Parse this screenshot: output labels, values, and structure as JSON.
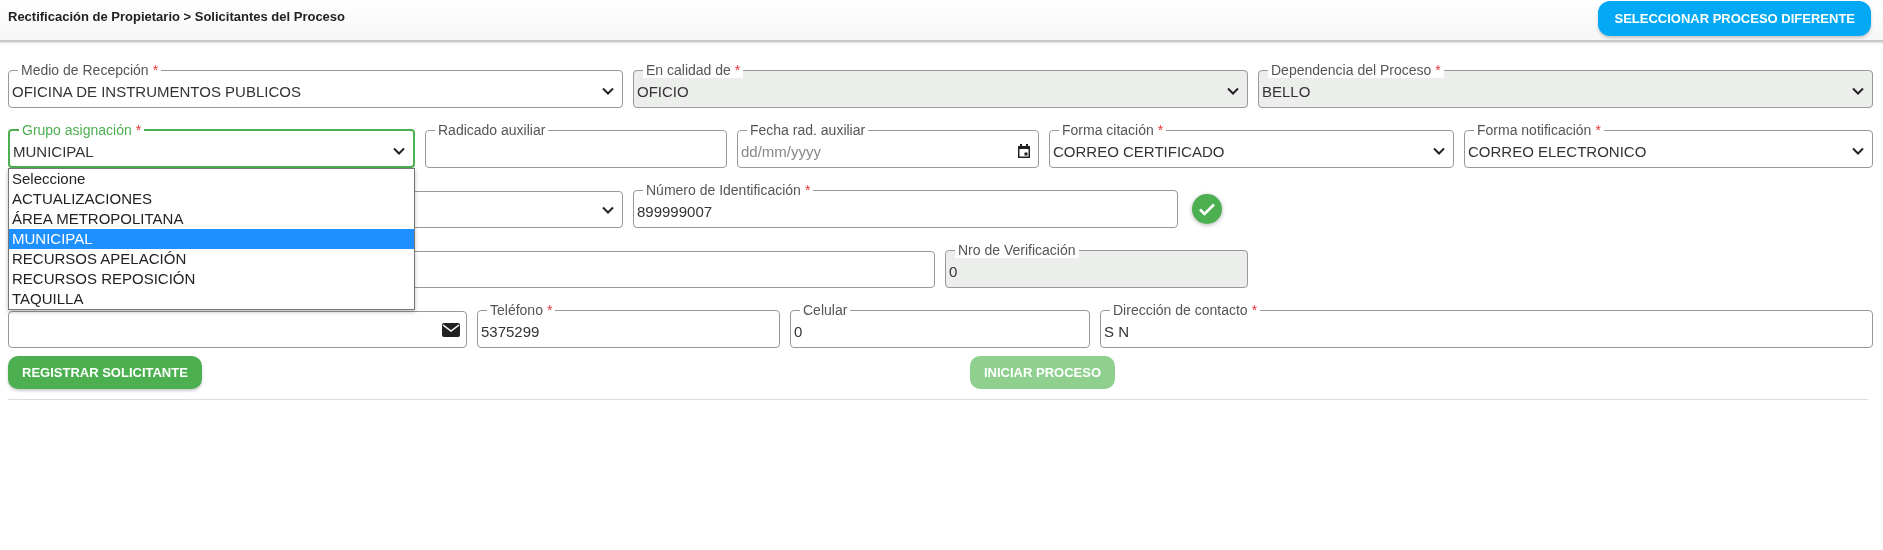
{
  "header": {
    "breadcrumb": "Rectificación de Propietario > Solicitantes del Proceso",
    "button": "SELECCIONAR PROCESO DIFERENTE"
  },
  "rows": [
    {
      "fields": [
        {
          "kind": "select",
          "label": "Medio de Recepción",
          "mark": "*",
          "value": "OFICINA DE INSTRUMENTOS PUBLICOS",
          "disabled": false,
          "focused": false
        },
        {
          "kind": "select",
          "label": "En calidad de",
          "mark": "*",
          "value": "OFICIO",
          "disabled": true,
          "focused": false
        },
        {
          "kind": "select",
          "label": "Dependencia del Proceso",
          "mark": "*",
          "value": "BELLO",
          "disabled": true,
          "focused": false
        }
      ]
    },
    {
      "fields": [
        {
          "kind": "select",
          "label": "Grupo asignación",
          "mark": "*",
          "value": "MUNICIPAL",
          "disabled": false,
          "focused": true,
          "expanded": true,
          "options": [
            {
              "label": "Seleccione",
              "selected": false
            },
            {
              "label": "ACTUALIZACIONES",
              "selected": false
            },
            {
              "label": "ÁREA METROPOLITANA",
              "selected": false
            },
            {
              "label": "MUNICIPAL",
              "selected": true
            },
            {
              "label": "RECURSOS APELACIÓN",
              "selected": false
            },
            {
              "label": "RECURSOS REPOSICIÓN",
              "selected": false
            },
            {
              "label": "TAQUILLA",
              "selected": false
            }
          ]
        },
        {
          "kind": "input",
          "label": "Radicado auxiliar",
          "disabled": false,
          "focused": false
        },
        {
          "kind": "date",
          "label": "Fecha rad. auxiliar",
          "placeholder": "dd/mm/yyyy",
          "disabled": false,
          "focused": false
        },
        {
          "kind": "select",
          "label": "Forma citación",
          "mark": "*",
          "value": "CORREO CERTIFICADO",
          "disabled": false,
          "focused": false
        },
        {
          "kind": "select",
          "label": "Forma notificación",
          "mark": "*",
          "value": "CORREO ELECTRONICO",
          "disabled": false,
          "focused": false
        }
      ]
    },
    {
      "fields": [
        {
          "kind": "select",
          "disabled": false,
          "focused": false
        },
        {
          "kind": "input",
          "label": "Número de Identificación",
          "mark": "*",
          "value": "899999007",
          "disabled": false,
          "focused": false
        },
        {
          "kind": "check"
        }
      ]
    },
    {
      "fields": [
        {
          "kind": "input",
          "disabled": false,
          "focused": false
        },
        {
          "kind": "input",
          "label": "Nro de Verificación",
          "value": "0",
          "disabled": true,
          "focused": false
        }
      ]
    },
    {
      "fields": [
        {
          "kind": "email",
          "disabled": false,
          "focused": false
        },
        {
          "kind": "input",
          "label": "Teléfono",
          "mark": "*",
          "value": "5375299",
          "disabled": false,
          "focused": false
        },
        {
          "kind": "input",
          "label": "Celular",
          "value": "0",
          "disabled": false,
          "focused": false
        },
        {
          "kind": "input",
          "label": "Dirección de contacto",
          "mark": "*",
          "value": "S N",
          "disabled": false,
          "focused": false
        }
      ]
    }
  ],
  "actions": [
    {
      "label": "REGISTRAR SOLICITANTE",
      "disabled": false
    },
    {
      "label": "INICIAR PROCESO",
      "disabled": true
    }
  ]
}
